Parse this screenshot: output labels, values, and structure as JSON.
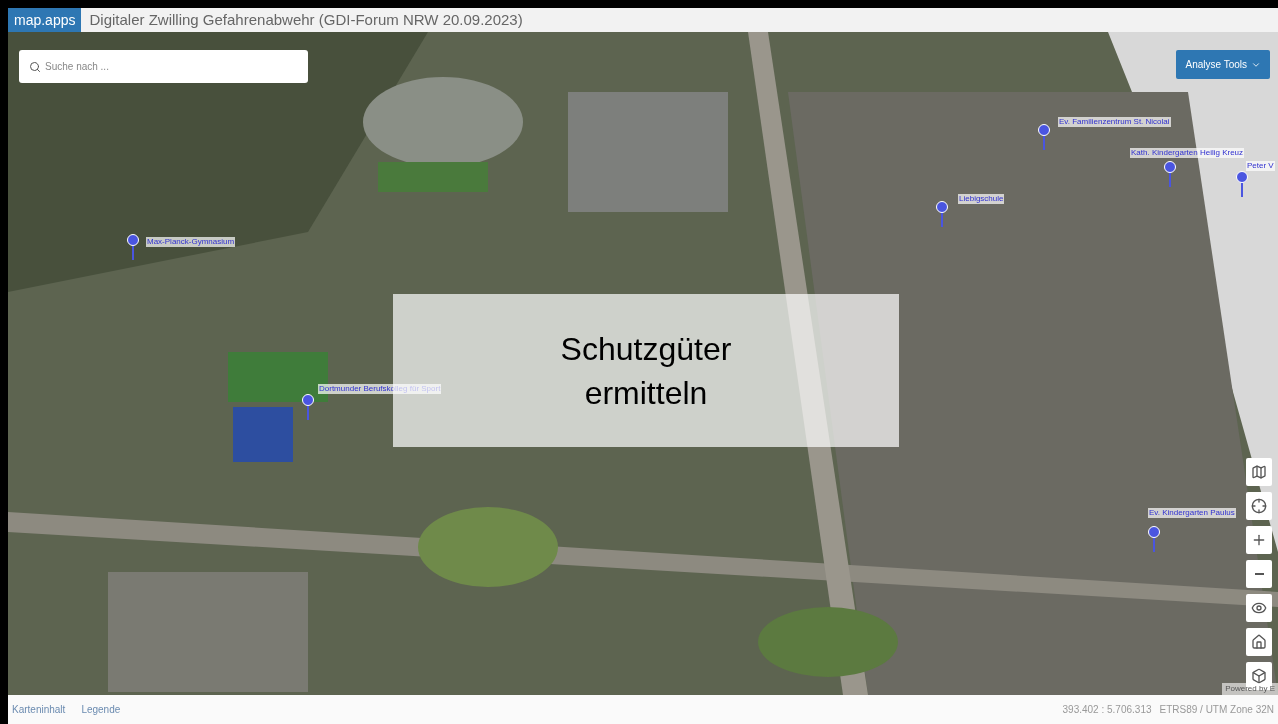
{
  "header": {
    "logo": "map.apps",
    "title": "Digitaler Zwilling Gefahrenabwehr (GDI-Forum NRW 20.09.2023)"
  },
  "search": {
    "placeholder": "Suche nach ..."
  },
  "analyse_button": {
    "label": "Analyse Tools"
  },
  "overlay": {
    "lines": [
      "Schutzgüter",
      "ermitteln"
    ]
  },
  "pois": [
    {
      "label": "Max-Planck-Gymnasium"
    },
    {
      "label": "Dortmunder Berufskolleg für Sport"
    },
    {
      "label": "Ev. Familienzentrum St. Nicolai"
    },
    {
      "label": "Kath. Kindergarten Heilig Kreuz"
    },
    {
      "label": "Peter V"
    },
    {
      "label": "Liebigschule"
    },
    {
      "label": "Ev. Kindergarten Paulus"
    }
  ],
  "map_controls": [
    {
      "kind": "gallery"
    },
    {
      "kind": "locate"
    },
    {
      "kind": "zoom-in"
    },
    {
      "kind": "zoom-out"
    },
    {
      "kind": "view"
    },
    {
      "kind": "home"
    },
    {
      "kind": "flat"
    }
  ],
  "attribution": "Powered by E",
  "footer": {
    "tabs": [
      "Karteninhalt",
      "Legende"
    ],
    "coordinates": "393.402 : 5.706.313",
    "reference": "ETRS89 / UTM Zone 32N"
  }
}
